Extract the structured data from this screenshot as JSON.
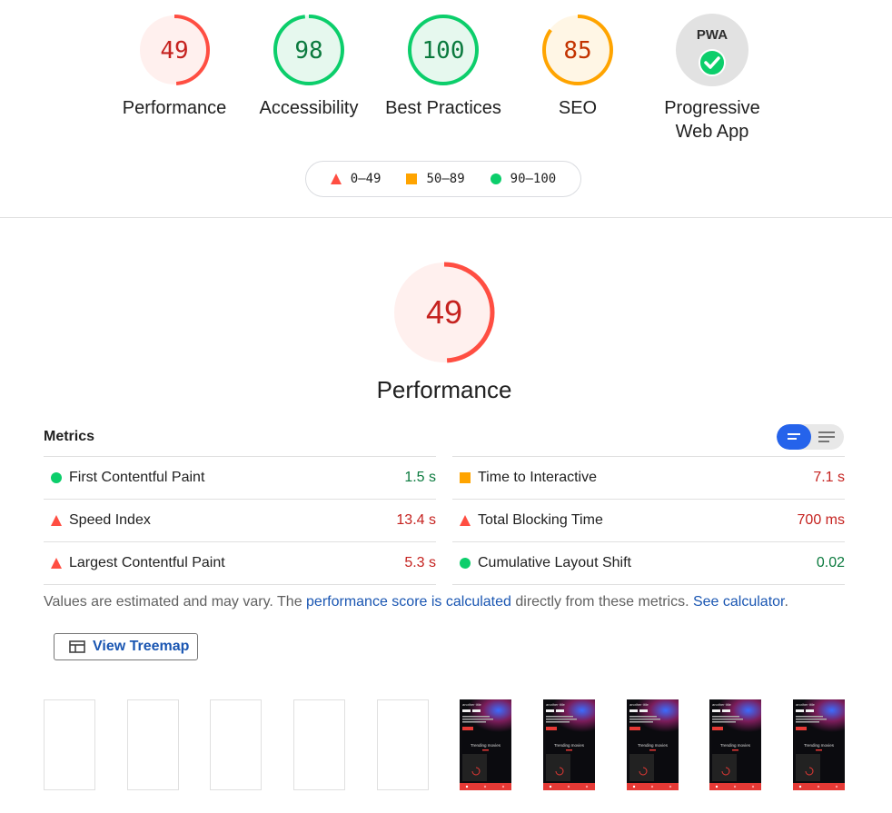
{
  "colors": {
    "fail": "#ff4e42",
    "average": "#ffa400",
    "pass": "#0cce6b",
    "fail_text": "#c5221f",
    "pass_text": "#0b7a3e",
    "link": "#1a56b2"
  },
  "gauges": [
    {
      "score": "49",
      "score_value": 49,
      "label": "Performance",
      "status": "fail"
    },
    {
      "score": "98",
      "score_value": 98,
      "label": "Accessibility",
      "status": "pass"
    },
    {
      "score": "100",
      "score_value": 100,
      "label": "Best Practices",
      "status": "pass"
    },
    {
      "score": "85",
      "score_value": 85,
      "label": "SEO",
      "status": "average"
    },
    {
      "label": "Progressive Web App",
      "badge": "PWA",
      "icon": "pwa-check-icon"
    }
  ],
  "legend": [
    {
      "shape": "triangle",
      "range": "0–49"
    },
    {
      "shape": "square",
      "range": "50–89"
    },
    {
      "shape": "circle",
      "range": "90–100"
    }
  ],
  "main_gauge": {
    "score": "49",
    "score_value": 49,
    "label": "Performance"
  },
  "metrics": {
    "title": "Metrics",
    "left": [
      {
        "name": "First Contentful Paint",
        "value": "1.5 s",
        "status": "pass"
      },
      {
        "name": "Speed Index",
        "value": "13.4 s",
        "status": "fail"
      },
      {
        "name": "Largest Contentful Paint",
        "value": "5.3 s",
        "status": "fail"
      }
    ],
    "right": [
      {
        "name": "Time to Interactive",
        "value": "7.1 s",
        "status": "average"
      },
      {
        "name": "Total Blocking Time",
        "value": "700 ms",
        "status": "fail"
      },
      {
        "name": "Cumulative Layout Shift",
        "value": "0.02",
        "status": "pass"
      }
    ]
  },
  "note": {
    "prefix": "Values are estimated and may vary. The ",
    "link1": "performance score is calculated",
    "middle": " directly from these metrics. ",
    "link2": "See calculator",
    "suffix": "."
  },
  "treemap_button": "View Treemap",
  "filmstrip": {
    "frames": [
      "blank",
      "blank",
      "blank",
      "blank",
      "blank",
      "shot",
      "shot",
      "shot",
      "shot",
      "shot"
    ],
    "shot_text": {
      "title": "another title",
      "caption": "Trending movies"
    }
  }
}
